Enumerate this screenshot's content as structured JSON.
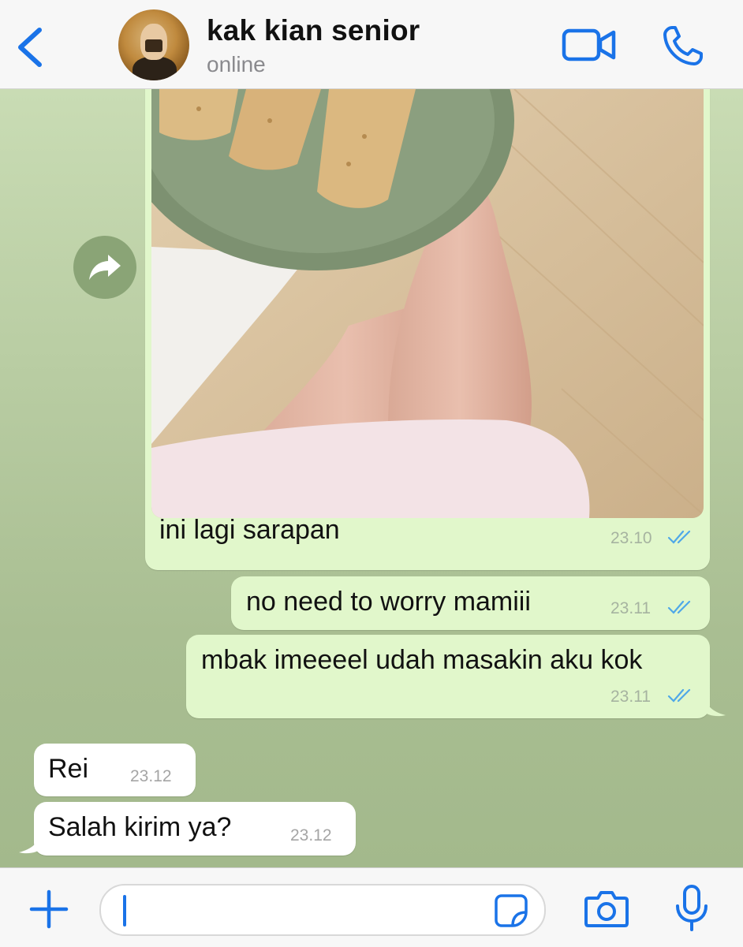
{
  "header": {
    "contact_name": "kak kian senior",
    "status": "online",
    "icons": [
      "chevron-left-icon",
      "video-camera-icon",
      "phone-icon"
    ],
    "accent_color": "#1a73e8"
  },
  "messages": [
    {
      "direction": "outgoing",
      "type": "image",
      "caption": "ini lagi sarapan",
      "time": "23.10",
      "read": true
    },
    {
      "direction": "outgoing",
      "type": "text",
      "text": "no need to worry mamiii",
      "time": "23.11",
      "read": true
    },
    {
      "direction": "outgoing",
      "type": "text",
      "text": "mbak imeeeel udah masakin aku kok",
      "time": "23.11",
      "read": true
    },
    {
      "direction": "incoming",
      "type": "text",
      "text": "Rei",
      "time": "23.12"
    },
    {
      "direction": "incoming",
      "type": "text",
      "text": "Salah kirim ya?",
      "time": "23.12"
    }
  ],
  "composer": {
    "placeholder": "",
    "icons": [
      "plus-icon",
      "sticker-icon",
      "camera-icon",
      "microphone-icon"
    ]
  },
  "colors": {
    "outgoing_bubble": "#e1f7cb",
    "incoming_bubble": "#ffffff",
    "chat_background": "#b9cda3",
    "read_ticks": "#4fa8e8"
  }
}
